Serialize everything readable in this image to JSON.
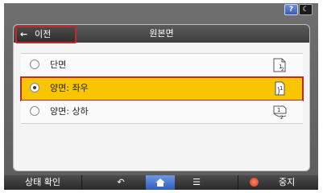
{
  "topbar": {
    "help_label": "?",
    "moon_icon": "moon-icon"
  },
  "dialog": {
    "back_label": "이전",
    "back_icon": "arrow-left-icon",
    "title": "원본면",
    "options": [
      {
        "label": "단면",
        "selected": false,
        "icon": "single-sided-page-icon"
      },
      {
        "label": "양면: 좌우",
        "selected": true,
        "icon": "duplex-left-right-icon"
      },
      {
        "label": "양면: 상하",
        "selected": false,
        "icon": "duplex-top-bottom-icon"
      }
    ]
  },
  "bottombar": {
    "status_label": "상태 확인",
    "back_icon": "back-arrow-icon",
    "home_icon": "home-icon",
    "menu_icon": "menu-icon",
    "stop_label": "중지",
    "stop_icon": "stop-icon"
  },
  "colors": {
    "selected_bg": "#f9c500",
    "highlight_border": "#c0282e",
    "home_blue": "#2f5dbd"
  }
}
